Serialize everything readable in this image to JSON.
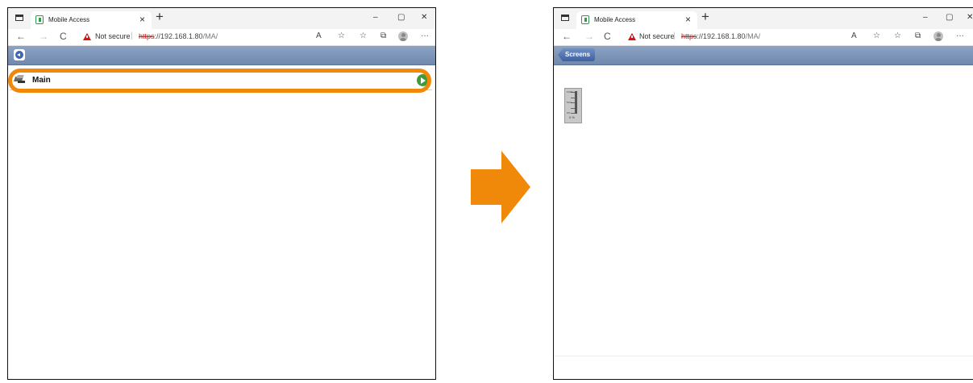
{
  "browser": {
    "tab_title": "Mobile Access",
    "tab_close": "×",
    "new_tab": "+",
    "minimize": "–",
    "restore": "▢",
    "close": "✕",
    "back": "←",
    "forward": "→",
    "refresh": "C",
    "not_secure": "Not secure",
    "separator": "|",
    "url_scheme": "https",
    "url_host": "://192.168.1.80",
    "url_path": "/MA/",
    "read_aloud": "A",
    "favorite": "☆",
    "favorites": "☆",
    "collections": "⧉",
    "more": "···"
  },
  "left_panel": {
    "screen_list": [
      {
        "label": "Main",
        "icon": "screen-icon",
        "action_icon": "arrow-right-icon"
      }
    ],
    "highlight_color": "#f0880a"
  },
  "right_panel": {
    "back_button_label": "Screens",
    "slider": {
      "tick_labels": [
        "100%",
        "50%",
        "0%"
      ],
      "value_label": "0 %"
    }
  },
  "transition_arrow": {
    "color": "#f0880a"
  }
}
